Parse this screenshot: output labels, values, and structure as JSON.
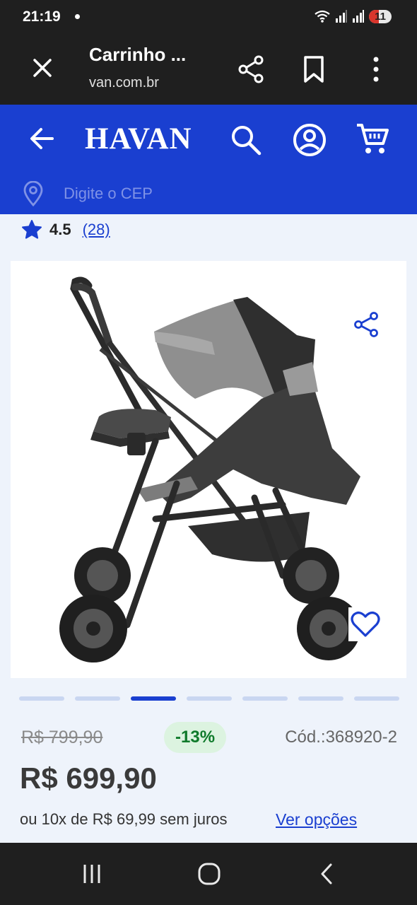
{
  "status": {
    "time": "21:19",
    "battery": "11",
    "icons": [
      "wifi-icon",
      "signal-icon",
      "signal-icon",
      "battery-icon"
    ]
  },
  "browser": {
    "title": "Carrinho ...",
    "url": "van.com.br",
    "icons": [
      "close-icon",
      "share-icon",
      "bookmark-icon",
      "more-vert-icon"
    ]
  },
  "header": {
    "logo": "HAVAN",
    "cep_placeholder": "Digite o CEP",
    "icons": [
      "arrow-back-icon",
      "search-icon",
      "account-icon",
      "cart-icon",
      "location-pin-icon"
    ],
    "brand_color": "#1a3fd0"
  },
  "product": {
    "rating": "4.5",
    "rating_count": "(28)",
    "image": "baby-stroller",
    "gallery": {
      "count": 7,
      "active_index": 2
    },
    "old_price": "R$ 799,90",
    "discount": "-13%",
    "code": "Cód.:368920-2",
    "price": "R$ 699,90",
    "installments": "ou 10x de R$ 69,99 sem juros",
    "see_options": "Ver opções"
  },
  "colors": {
    "discount_text": "#0f7a2b",
    "discount_bg": "#dcf3e0",
    "star": "#1a3fd0"
  }
}
